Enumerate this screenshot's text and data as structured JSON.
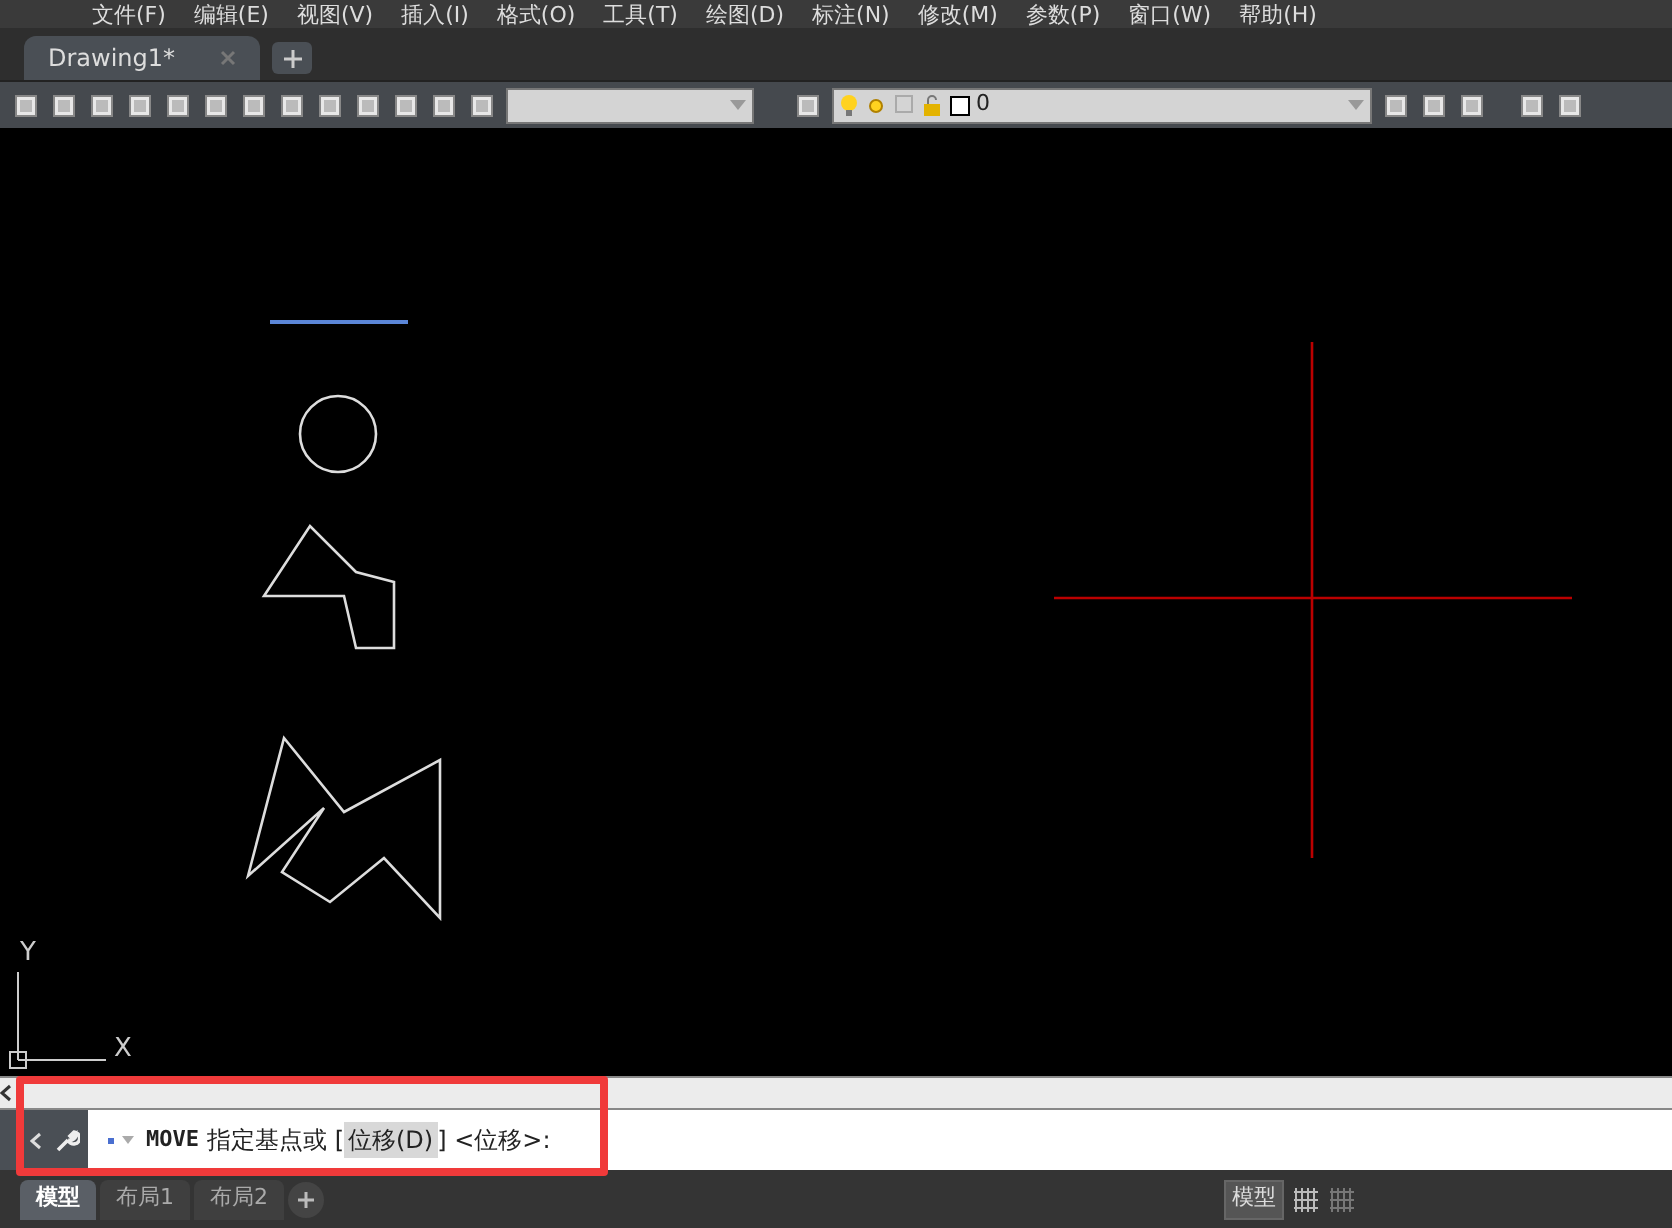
{
  "menu_bar": {
    "items": [
      "文件(F)",
      "编辑(E)",
      "视图(V)",
      "插入(I)",
      "格式(O)",
      "工具(T)",
      "绘图(D)",
      "标注(N)",
      "修改(M)",
      "参数(P)",
      "窗口(W)",
      "帮助(H)"
    ]
  },
  "file_tabs": [
    {
      "label": "Drawing1*",
      "selected": true
    }
  ],
  "toolbar": {
    "layer": "0"
  },
  "canvas": {
    "axis_y": "Y",
    "axis_x": "X"
  },
  "command_line": {
    "name": "MOVE",
    "prompt": "指定基点或 [",
    "option": "位移(D)",
    "suffix": "] <位移>:"
  },
  "layout_tabs": [
    {
      "label": "模型",
      "selected": true
    },
    {
      "label": "布局1",
      "selected": false
    },
    {
      "label": "布局2",
      "selected": false
    }
  ],
  "status_bar": {
    "model_button": "模型"
  }
}
